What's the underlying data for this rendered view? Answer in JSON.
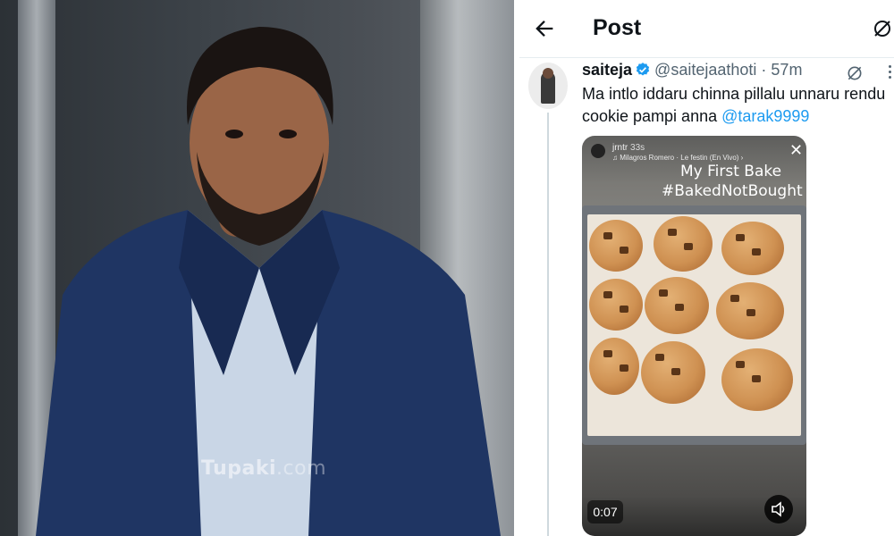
{
  "photo": {
    "watermark": "Tupaki",
    "watermark_suffix": ".com"
  },
  "topbar": {
    "title": "Post",
    "back_icon": "arrow-left-icon",
    "grok_icon": "grok-icon"
  },
  "post": {
    "display_name": "saiteja",
    "verified": true,
    "handle": "@saitejaathoti",
    "separator": "·",
    "time": "57m",
    "text": "Ma intlo iddaru chinna pillalu unnaru rendu cookie pampi anna ",
    "mention": "@tarak9999"
  },
  "media": {
    "story_user": "jrntr",
    "story_time": "33s",
    "story_music": "♫ Milagros Romero · Le festin (En Vivo) ›",
    "caption_line1": "My First Bake",
    "caption_line2": "#BakedNotBought",
    "video_time": "0:07",
    "close_icon": "close-icon",
    "volume_icon": "volume-icon"
  },
  "colors": {
    "accent": "#1d9bf0",
    "text": "#0f1419",
    "secondary": "#536471",
    "border": "#cfd9de"
  }
}
